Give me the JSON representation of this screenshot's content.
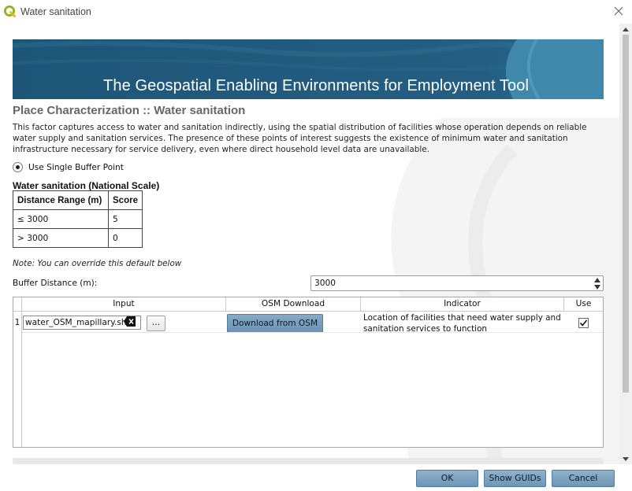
{
  "window": {
    "title": "Water sanitation"
  },
  "banner": {
    "title": "The Geospatial Enabling Environments for Employment Tool"
  },
  "section": {
    "title": "Place Characterization :: Water sanitation",
    "description": "This factor captures access to water and sanitation indirectly, using the spatial distribution of facilities whose operation depends on reliable water supply and sanitation services. The presence of these points of interest suggests the existence of minimum water and sanitation infrastructure necessary for service delivery, even where direct household level data are unavailable."
  },
  "radio": {
    "label": "Use Single Buffer Point",
    "checked": true
  },
  "scale_table": {
    "title": "Water sanitation (National Scale)",
    "headers": [
      "Distance Range (m)",
      "Score"
    ],
    "rows": [
      [
        "≤ 3000",
        "5"
      ],
      [
        "> 3000",
        "0"
      ]
    ]
  },
  "note": "Note: You can override this default below",
  "buffer": {
    "label": "Buffer Distance (m):",
    "value": "3000"
  },
  "input_table": {
    "headers": [
      "Input",
      "OSM Download",
      "Indicator",
      "Use"
    ],
    "rows": [
      {
        "num": "1",
        "file": "water_OSM_mapillary.shp",
        "browse": "...",
        "osm_button": "Download from OSM",
        "indicator": "Location of facilities that need water supply and sanitation services to function",
        "use": true
      }
    ]
  },
  "buttons": {
    "ok": "OK",
    "show_guids": "Show GUIDs",
    "cancel": "Cancel"
  },
  "colors": {
    "banner": "#1f5a7a",
    "button": "#7ba1bf",
    "qgis_green": "#93b023"
  },
  "icons": [
    "qgis-logo-icon",
    "close-icon",
    "clear-icon",
    "spin-up-icon",
    "spin-down-icon",
    "checkmark-icon",
    "scroll-up-icon",
    "scroll-down-icon"
  ]
}
